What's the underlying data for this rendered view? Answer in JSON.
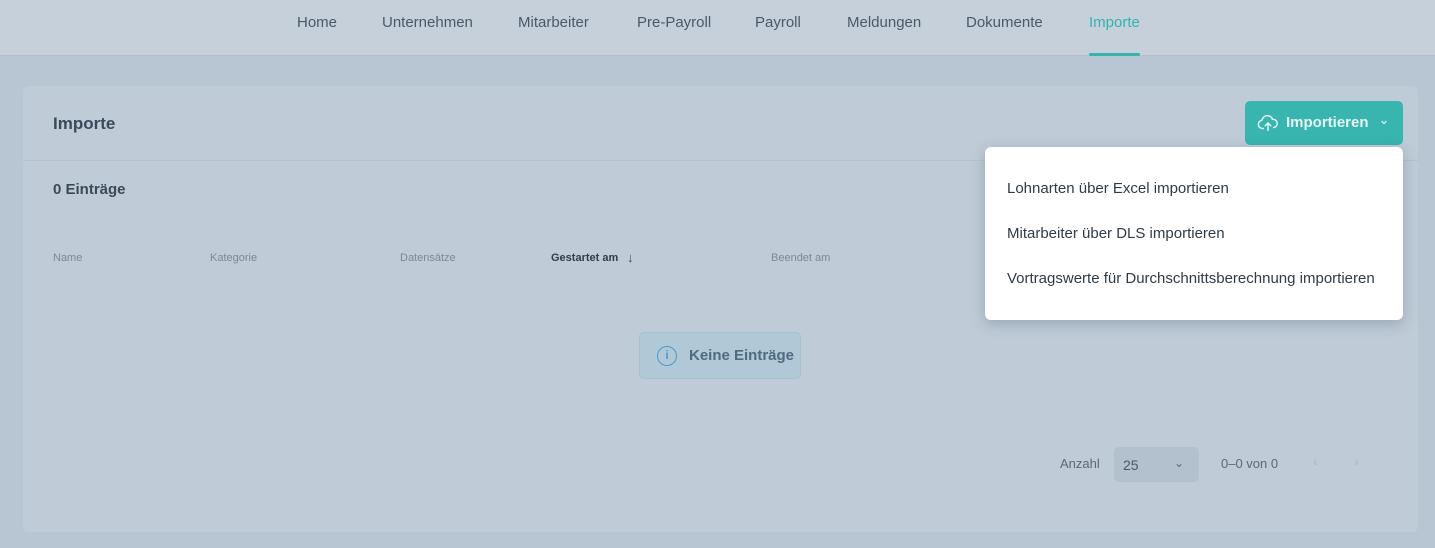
{
  "nav": {
    "items": [
      {
        "label": "Home",
        "active": false
      },
      {
        "label": "Unternehmen",
        "active": false
      },
      {
        "label": "Mitarbeiter",
        "active": false
      },
      {
        "label": "Pre-Payroll",
        "active": false
      },
      {
        "label": "Payroll",
        "active": false
      },
      {
        "label": "Meldungen",
        "active": false
      },
      {
        "label": "Dokumente",
        "active": false
      },
      {
        "label": "Importe",
        "active": true
      }
    ]
  },
  "page": {
    "title": "Importe",
    "count_label": "0 Einträge",
    "import_button": {
      "label": "Importieren",
      "icon": "cloud-upload-icon"
    }
  },
  "table": {
    "columns": [
      {
        "label": "Name",
        "sorted": false
      },
      {
        "label": "Kategorie",
        "sorted": false
      },
      {
        "label": "Datensätze",
        "sorted": false
      },
      {
        "label": "Gestartet am",
        "sorted": true,
        "sort_direction": "desc"
      },
      {
        "label": "Beendet am",
        "sorted": false
      }
    ],
    "empty_message": "Keine Einträge"
  },
  "pagination": {
    "rows_label": "Anzahl",
    "rows_per_page": "25",
    "range": "0–0 von 0"
  },
  "menu": {
    "items": [
      "Lohnarten über Excel importieren",
      "Mitarbeiter über DLS importieren",
      "Vortragswerte für Durchschnittsberechnung importieren"
    ]
  },
  "colors": {
    "accent": "#35b3ad",
    "overlay_background": "#b8c5d3"
  }
}
